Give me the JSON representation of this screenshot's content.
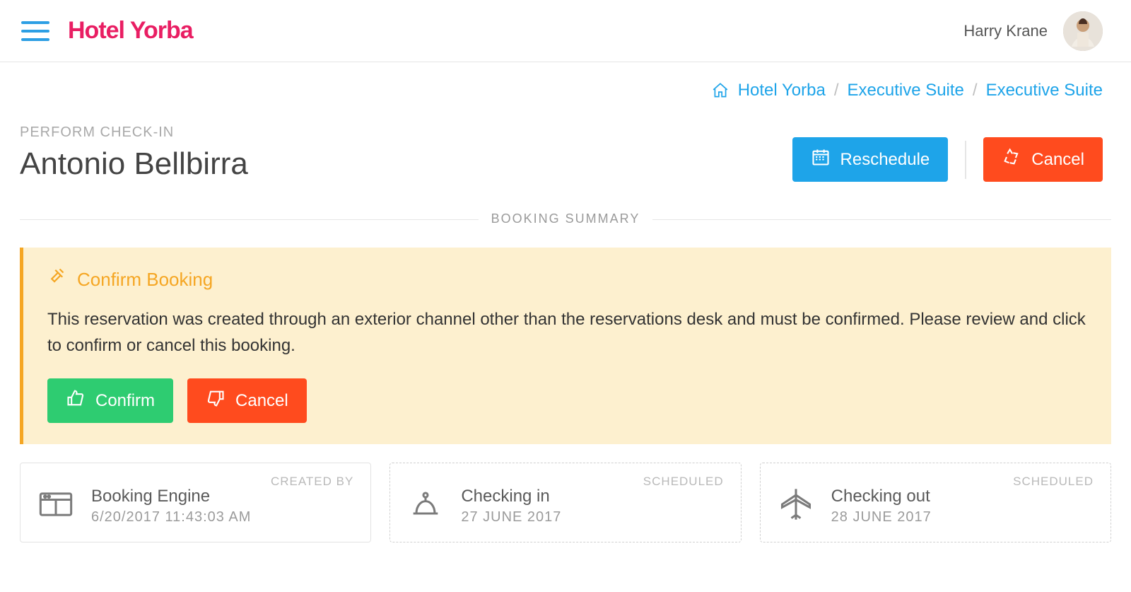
{
  "header": {
    "brand": "Hotel Yorba",
    "username": "Harry Krane"
  },
  "breadcrumbs": {
    "home": "Hotel Yorba",
    "mid": "Executive Suite",
    "last": "Executive Suite"
  },
  "page": {
    "kicker": "PERFORM CHECK-IN",
    "guest_name": "Antonio Bellbirra",
    "reschedule_label": "Reschedule",
    "cancel_label": "Cancel",
    "section_label": "BOOKING SUMMARY"
  },
  "alert": {
    "title": "Confirm Booking",
    "body": "This reservation was created through an exterior channel other than the reservations desk and must be confirmed. Please review and click to confirm or cancel this booking.",
    "confirm_label": "Confirm",
    "cancel_label": "Cancel"
  },
  "cards": {
    "created": {
      "tag": "CREATED BY",
      "title": "Booking Engine",
      "sub": "6/20/2017 11:43:03 AM"
    },
    "checkin": {
      "tag": "SCHEDULED",
      "title": "Checking in",
      "sub": "27 JUNE 2017"
    },
    "checkout": {
      "tag": "SCHEDULED",
      "title": "Checking out",
      "sub": "28 JUNE 2017"
    }
  }
}
